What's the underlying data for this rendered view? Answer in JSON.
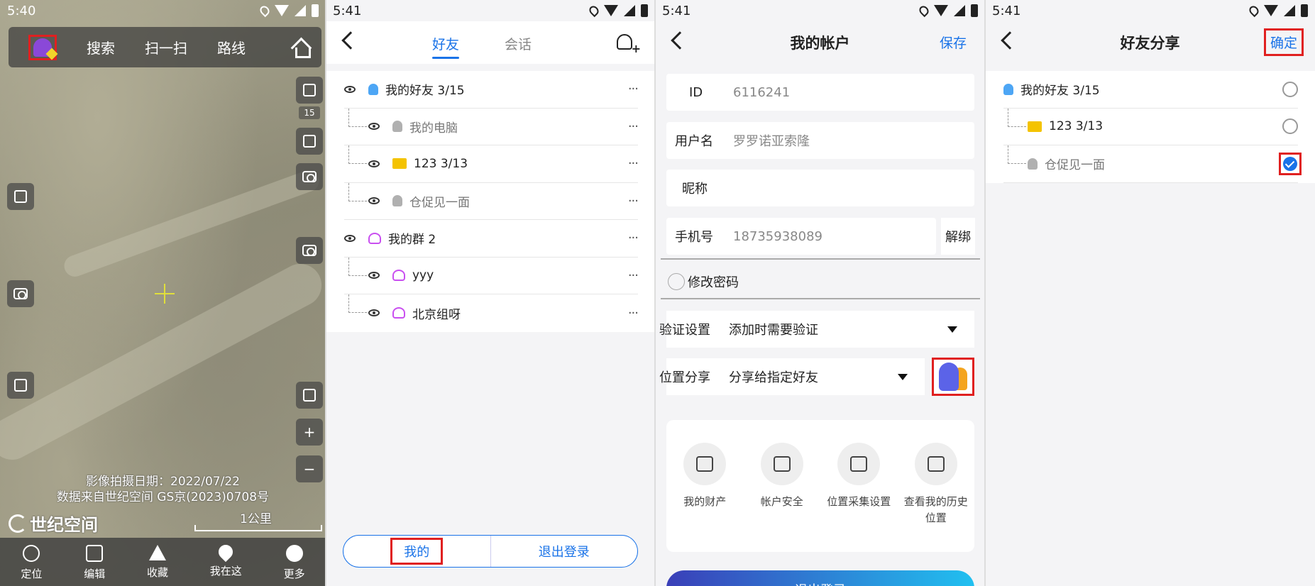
{
  "panel1": {
    "status_time": "5:40",
    "topbar": {
      "search": "搜索",
      "scan": "扫一扫",
      "route": "路线"
    },
    "zoom_level": "15",
    "image_date": "影像拍摄日期：2022/07/22",
    "data_source": "数据来自世纪空间 GS京(2023)0708号",
    "brand": "世纪空间",
    "scale_label": "1公里",
    "bottom_tabs": [
      "定位",
      "编辑",
      "收藏",
      "我在这",
      "更多"
    ]
  },
  "panel2": {
    "status_time": "5:41",
    "tabs": [
      "好友",
      "会话"
    ],
    "tree": [
      {
        "label": "我的好友 3/15",
        "level": 0,
        "icon": "user-icon"
      },
      {
        "label": "我的电脑",
        "level": 1,
        "icon": "user-icon"
      },
      {
        "label": "123 3/13",
        "level": 1,
        "icon": "folder-icon"
      },
      {
        "label": "仓促见一面",
        "level": 1,
        "icon": "user-icon"
      },
      {
        "label": "我的群 2",
        "level": 0,
        "icon": "group-icon"
      },
      {
        "label": "yyy",
        "level": 1,
        "icon": "group-icon"
      },
      {
        "label": "北京组呀",
        "level": 1,
        "icon": "group-icon"
      }
    ],
    "more_glyph": "···",
    "buttons": {
      "mine": "我的",
      "logout": "退出登录"
    }
  },
  "panel3": {
    "status_time": "5:41",
    "title": "我的帐户",
    "save": "保存",
    "fields": {
      "id_label": "ID",
      "id_value": "6116241",
      "username_label": "用户名",
      "username_value": "罗罗诺亚索隆",
      "nickname_label": "昵称",
      "phone_label": "手机号",
      "phone_value": "18735938089"
    },
    "unbind": "解绑",
    "change_password": "修改密码",
    "verify_label": "验证设置",
    "verify_value": "添加时需要验证",
    "location_label": "位置分享",
    "location_value": "分享给指定好友",
    "grid": [
      "我的财产",
      "帐户安全",
      "位置采集设置",
      "查看我的历史位置"
    ],
    "logout": "退出登录"
  },
  "panel4": {
    "status_time": "5:41",
    "title": "好友分享",
    "confirm": "确定",
    "items": [
      {
        "label": "我的好友 3/15",
        "checked": false
      },
      {
        "label": "123 3/13",
        "checked": false
      },
      {
        "label": "仓促见一面",
        "checked": true
      }
    ]
  }
}
